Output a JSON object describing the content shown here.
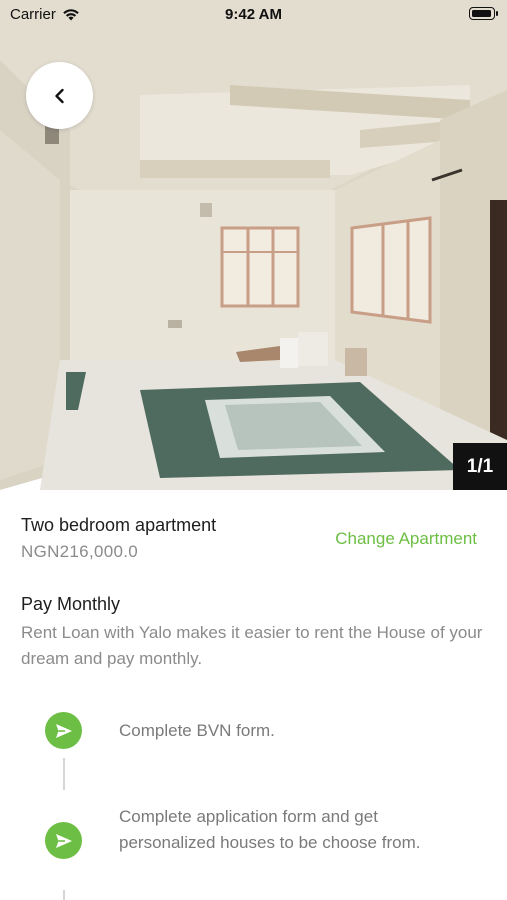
{
  "status_bar": {
    "carrier": "Carrier",
    "time": "9:42 AM"
  },
  "gallery": {
    "counter": "1/1"
  },
  "apartment": {
    "title": "Two bedroom apartment",
    "price": "NGN216,000.0",
    "change_label": "Change Apartment"
  },
  "plan": {
    "title": "Pay Monthly",
    "description": "Rent Loan with Yalo makes it easier to rent the House of your dream and pay monthly."
  },
  "steps": [
    {
      "text": "Complete BVN form.",
      "icon": "send-icon"
    },
    {
      "text": "Complete application form and get personalized houses to be choose from.",
      "icon": "send-icon"
    }
  ],
  "colors": {
    "accent": "#6cbf44",
    "muted_text": "#8b8b8b"
  }
}
